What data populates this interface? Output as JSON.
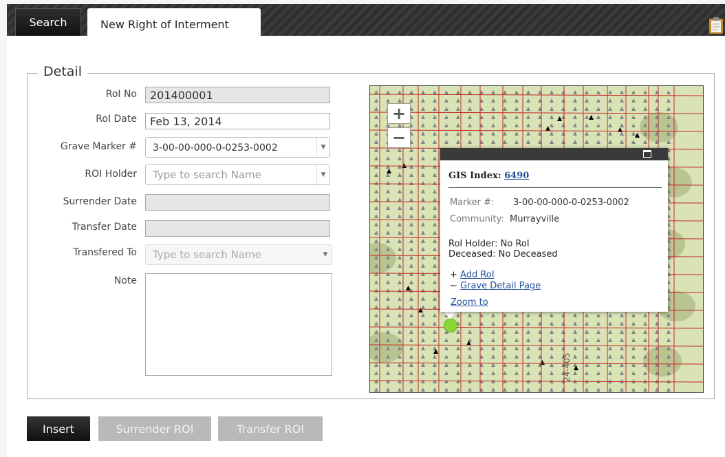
{
  "tabs": {
    "search": "Search",
    "new_roi": "New Right of Interment"
  },
  "detail": {
    "legend": "Detail",
    "roi_no": {
      "label": "RoI No",
      "value": "201400001"
    },
    "roi_date": {
      "label": "RoI Date",
      "value": "Feb 13, 2014"
    },
    "grave_marker": {
      "label": "Grave Marker #",
      "value": "3-00-00-000-0-0253-0002"
    },
    "roi_holder": {
      "label": "ROI Holder",
      "placeholder": "Type to search Name"
    },
    "surrender_date": {
      "label": "Surrender Date",
      "value": ""
    },
    "transfer_date": {
      "label": "Transfer Date",
      "value": ""
    },
    "transfered_to": {
      "label": "Transfered To",
      "placeholder": "Type to search Name"
    },
    "note": {
      "label": "Note",
      "value": ""
    }
  },
  "map": {
    "zoom_in": "+",
    "zoom_out": "−",
    "road_label": "24-405",
    "popup": {
      "gis_label": "GIS Index:",
      "gis_value": "6490",
      "marker_label": "Marker #:",
      "marker_value": "3-00-00-000-0-0253-0002",
      "community_label": "Community:",
      "community_value": "Murrayville",
      "roi_holder": "RoI Holder: No RoI",
      "deceased": "Deceased: No Deceased",
      "add_prefix": "+",
      "add_roi": "Add RoI",
      "grave_prefix": "~",
      "grave_detail": "Grave Detail Page",
      "zoom_to": "Zoom to"
    }
  },
  "buttons": {
    "insert": "Insert",
    "surrender": "Surrender ROI",
    "transfer": "Transfer ROI"
  }
}
